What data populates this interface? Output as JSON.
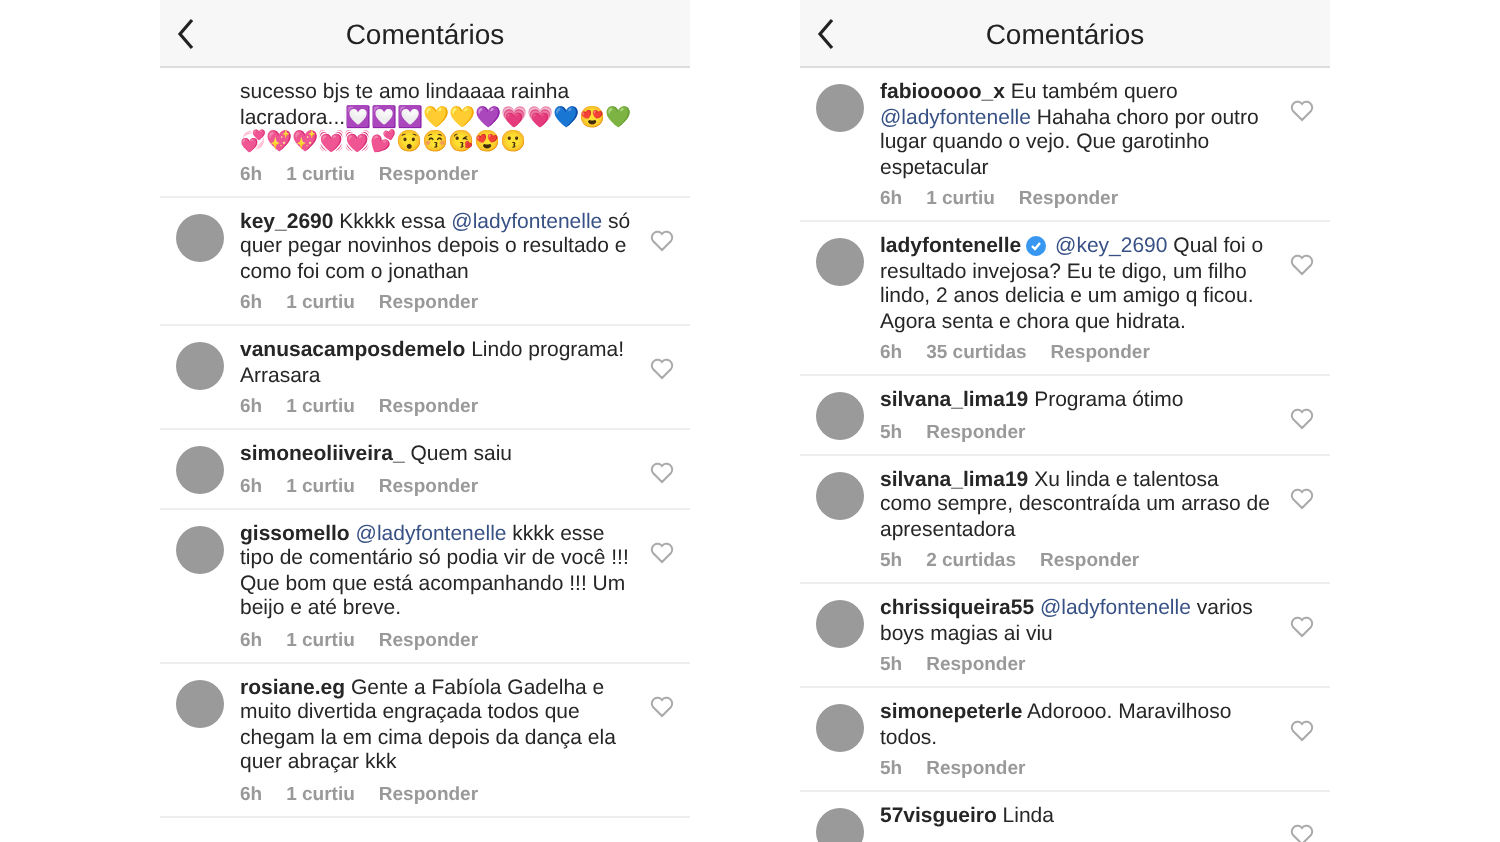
{
  "panels": [
    {
      "title": "Comentários",
      "comments": [
        {
          "verified": false,
          "segments": [
            {
              "kind": "plain",
              "text": "sucesso bjs te amo lindaaaa rainha lacradora...💟💟💟💛💛💜💗💗💙😍💚💞💖💖💓💓💕😯😚😘😍😗"
            }
          ],
          "time": "6h",
          "likes": "1 curtiu",
          "reply": "Responder"
        },
        {
          "user": "key_2690",
          "verified": false,
          "segments": [
            {
              "kind": "plain",
              "text": "Kkkkk  essa "
            },
            {
              "kind": "mention",
              "text": "@ladyfontenelle"
            },
            {
              "kind": "plain",
              "text": " só quer pegar novinhos depois o resultado e como foi com o jonathan"
            }
          ],
          "time": "6h",
          "likes": "1 curtiu",
          "reply": "Responder"
        },
        {
          "user": "vanusacamposdemelo",
          "verified": false,
          "segments": [
            {
              "kind": "plain",
              "text": "Lindo programa! Arrasara"
            }
          ],
          "time": "6h",
          "likes": "1 curtiu",
          "reply": "Responder"
        },
        {
          "user": "simoneoliiveira_",
          "verified": false,
          "segments": [
            {
              "kind": "plain",
              "text": "Quem saiu"
            }
          ],
          "time": "6h",
          "likes": "1 curtiu",
          "reply": "Responder"
        },
        {
          "user": "gissomello",
          "verified": false,
          "segments": [
            {
              "kind": "mention",
              "text": "@ladyfontenelle"
            },
            {
              "kind": "plain",
              "text": " kkkk esse tipo de comentário só podia vir de você !!! Que bom que está acompanhando !!! Um beijo e até breve."
            }
          ],
          "time": "6h",
          "likes": "1 curtiu",
          "reply": "Responder"
        },
        {
          "user": "rosiane.eg",
          "verified": false,
          "segments": [
            {
              "kind": "plain",
              "text": "Gente a Fabíola Gadelha e muito divertida engraçada todos que chegam la em cima depois da dança ela quer abraçar kkk"
            }
          ],
          "time": "6h",
          "likes": "1 curtiu",
          "reply": "Responder"
        }
      ]
    },
    {
      "title": "Comentários",
      "comments": [
        {
          "user": "fabiooooo_x",
          "verified": false,
          "segments": [
            {
              "kind": "plain",
              "text": "Eu também quero "
            },
            {
              "kind": "mention",
              "text": "@ladyfontenelle"
            },
            {
              "kind": "plain",
              "text": "  Hahaha choro por outro lugar quando o vejo.  Que garotinho espetacular"
            }
          ],
          "time": "6h",
          "likes": "1 curtiu",
          "reply": "Responder"
        },
        {
          "user": "ladyfontenelle",
          "verified": true,
          "segments": [
            {
              "kind": "mention",
              "text": "@key_2690"
            },
            {
              "kind": "plain",
              "text": " Qual foi o resultado invejosa? Eu te digo, um filho lindo, 2 anos delicia e um amigo q ficou. Agora senta e chora que hidrata."
            }
          ],
          "time": "6h",
          "likes": "35 curtidas",
          "reply": "Responder"
        },
        {
          "user": "silvana_lima19",
          "verified": false,
          "segments": [
            {
              "kind": "plain",
              "text": "Programa ótimo"
            }
          ],
          "time": "5h",
          "reply": "Responder"
        },
        {
          "user": "silvana_lima19",
          "verified": false,
          "segments": [
            {
              "kind": "plain",
              "text": "Xu linda e talentosa como sempre, descontraída um arraso de apresentadora"
            }
          ],
          "time": "5h",
          "likes": "2 curtidas",
          "reply": "Responder"
        },
        {
          "user": "chrissiqueira55",
          "verified": false,
          "segments": [
            {
              "kind": "mention",
              "text": "@ladyfontenelle"
            },
            {
              "kind": "plain",
              "text": " varios boys magias ai viu"
            }
          ],
          "time": "5h",
          "reply": "Responder"
        },
        {
          "user": "simonepeterle",
          "verified": false,
          "segments": [
            {
              "kind": "plain",
              "text": "Adorooo.  Maravilhoso todos."
            }
          ],
          "time": "5h",
          "reply": "Responder"
        },
        {
          "user": "57visgueiro",
          "verified": false,
          "segments": [
            {
              "kind": "plain",
              "text": "Linda"
            }
          ]
        }
      ]
    }
  ]
}
